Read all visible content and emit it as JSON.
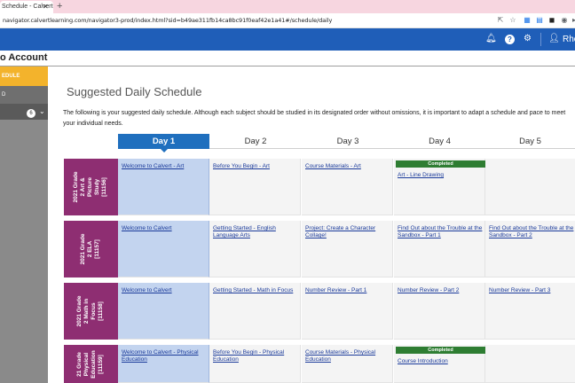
{
  "browser": {
    "tab_title": "Schedule - Calvert",
    "url": "navigator.calvertlearning.com/navigator3-prod/index.html?sid=b49ae311fb14ca8bc91f0eaf42e1a41#/schedule/daily"
  },
  "header": {
    "user_name": "Rho",
    "icons": [
      "bell-icon",
      "help-icon",
      "gear-icon",
      "user-icon"
    ]
  },
  "subheader": {
    "title": "o Account"
  },
  "sidebar": {
    "items": [
      {
        "label": "EDULE"
      },
      {
        "label": "D"
      },
      {
        "label": ""
      }
    ],
    "badge": "6"
  },
  "main": {
    "title": "Suggested Daily Schedule",
    "intro": "The following is your suggested daily schedule. Although each subject should be studied in its designated order without omissions, it is important to adapt a schedule and pace to meet your individual needs."
  },
  "days": [
    "Day 1",
    "Day 2",
    "Day 3",
    "Day 4",
    "Day 5"
  ],
  "completed_label": "Completed",
  "subjects": [
    {
      "label": "2021 Grade\n2 Art &\nPicture\nStudy\n[11156]",
      "cells": [
        {
          "text": "Welcome to Calvert - Art",
          "completed": false
        },
        {
          "text": "Before You Begin - Art",
          "completed": false
        },
        {
          "text": "Course Materials - Art",
          "completed": false
        },
        {
          "text": "Art - Line Drawing",
          "completed": true
        },
        {
          "text": "",
          "completed": false
        }
      ]
    },
    {
      "label": "2021 Grade\n2 ELA\n[11157]",
      "cells": [
        {
          "text": "Welcome to Calvert",
          "completed": false
        },
        {
          "text": "Getting Started - English Language Arts",
          "completed": false
        },
        {
          "text": "Project: Create a Character Collage!",
          "completed": false
        },
        {
          "text": "Find Out about the Trouble at the Sandbox - Part 1",
          "completed": false
        },
        {
          "text": "Find Out about the Trouble at the Sandbox - Part 2",
          "completed": false
        }
      ]
    },
    {
      "label": "2021 Grade\n2 Math in\nFocus\n[11158]",
      "cells": [
        {
          "text": "Welcome to Calvert",
          "completed": false
        },
        {
          "text": "Getting Started - Math in Focus",
          "completed": false
        },
        {
          "text": "Number Review - Part 1",
          "completed": false
        },
        {
          "text": "Number Review - Part 2",
          "completed": false
        },
        {
          "text": "Number Review - Part 3",
          "completed": false
        }
      ]
    },
    {
      "label": "21 Grade\nPhysical\nEducation\n[11159]",
      "cells": [
        {
          "text": "Welcome to Calvert - Physical Education",
          "completed": false
        },
        {
          "text": "Before You Begin - Physical Education",
          "completed": false
        },
        {
          "text": "Course Materials - Physical Education",
          "completed": false
        },
        {
          "text": "Course Introduction",
          "completed": true
        },
        {
          "text": "",
          "completed": false
        }
      ]
    }
  ]
}
